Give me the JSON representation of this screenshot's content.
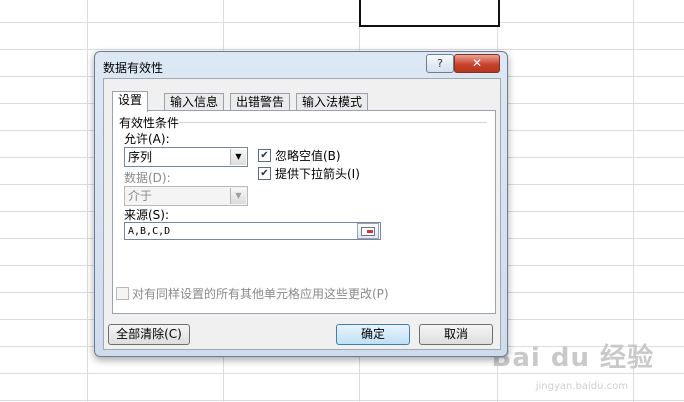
{
  "watermark": {
    "brand": "Bai du 经验",
    "url": "jingyan.baidu.com"
  },
  "dialog": {
    "title": "数据有效性",
    "help_glyph": "?",
    "close_glyph": "✕",
    "tabs": [
      "设置",
      "输入信息",
      "出错警告",
      "输入法模式"
    ],
    "active_tab": 0,
    "group_title": "有效性条件",
    "allow": {
      "label": "允许(A):",
      "value": "序列"
    },
    "data": {
      "label": "数据(D):",
      "value": "介于",
      "disabled": true
    },
    "ignore_blank": {
      "label": "忽略空值(B)",
      "checked": true
    },
    "in_cell_dropdown": {
      "label": "提供下拉箭头(I)",
      "checked": true
    },
    "source": {
      "label": "来源(S):",
      "value": "A,B,C,D"
    },
    "apply_all": {
      "label": "对有同样设置的所有其他单元格应用这些更改(P)",
      "checked": false,
      "disabled": true
    },
    "buttons": {
      "clear_all": "全部清除(C)",
      "ok": "确定",
      "cancel": "取消"
    }
  }
}
